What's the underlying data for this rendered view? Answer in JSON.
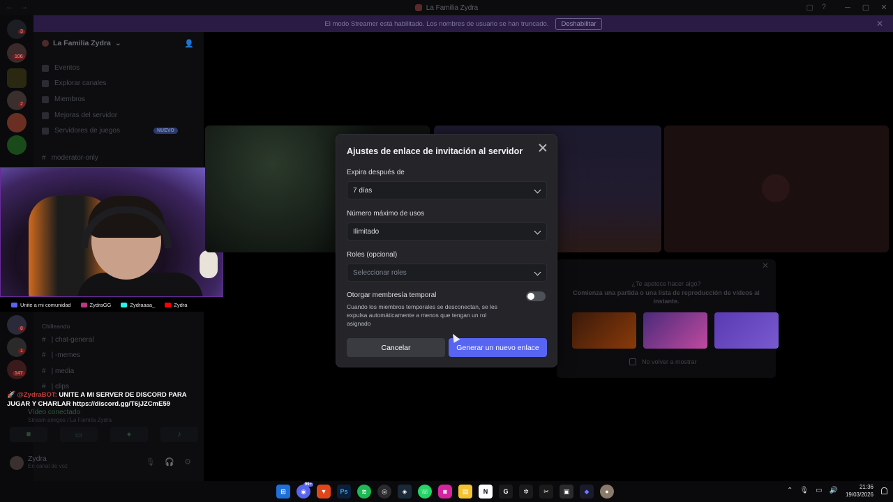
{
  "window": {
    "title": "La Familia Zydra"
  },
  "banner": {
    "text": "El modo Streamer está habilitado. Los nombres de usuario se han truncado.",
    "button": "Deshabilitar"
  },
  "rail_badges": [
    "3",
    "106",
    "2",
    "8",
    "1",
    "147"
  ],
  "sidebar": {
    "server_name": "La Familia Zydra",
    "items": [
      {
        "label": "Eventos"
      },
      {
        "label": "Explorar canales"
      },
      {
        "label": "Miembros"
      },
      {
        "label": "Mejoras del servidor"
      },
      {
        "label": "Servidores de juegos",
        "badge": "NUEVO"
      },
      {
        "label": "moderator-only"
      }
    ],
    "category": "Chilleando",
    "channels": [
      "| chat-general",
      "| -memes",
      "| media",
      "| clips"
    ]
  },
  "voice": {
    "status": "Vídeo conectado",
    "channel": "Stream amigos / La Familia Zydra"
  },
  "user": {
    "name": "Zydra",
    "status": "En canal de voz"
  },
  "socials": [
    {
      "label": "Unite a mi comunidad",
      "color": "#5865f2"
    },
    {
      "label": "ZydraGG",
      "color": "#c13584"
    },
    {
      "label": "Zydraaaa_",
      "color": "#25f4ee"
    },
    {
      "label": "Zydra",
      "color": "#ff0000"
    }
  ],
  "bot_message": {
    "author": "@ZydraBOT:",
    "text": "UNITE A MI SERVER DE DISCORD PARA JUGAR Y CHARLAR https://discord.gg/T6jJZCmE59"
  },
  "activity": {
    "question": "¿Te apetece hacer algo?",
    "description": "Comienza una partida o una lista de reproducción de vídeos al instante.",
    "dont_show": "No volver a mostrar"
  },
  "modal": {
    "title": "Ajustes de enlace de invitación al servidor",
    "expire_label": "Expira después de",
    "expire_value": "7 días",
    "max_uses_label": "Número máximo de usos",
    "max_uses_value": "Ilimitado",
    "roles_label": "Roles (opcional)",
    "roles_placeholder": "Seleccionar roles",
    "temp_label": "Otorgar membresía temporal",
    "temp_help": "Cuando los miembros temporales se desconectan, se les expulsa automáticamente a menos que tengan un rol asignado",
    "temp_enabled": false,
    "cancel": "Cancelar",
    "generate": "Generar un nuevo enlace"
  },
  "taskbar": {
    "discord_badge": "99+",
    "time": "21:36",
    "date": "19/03/2026"
  },
  "colors": {
    "accent": "#5865f2",
    "modal_bg": "#242429",
    "banner_bg": "#2a1b44"
  }
}
